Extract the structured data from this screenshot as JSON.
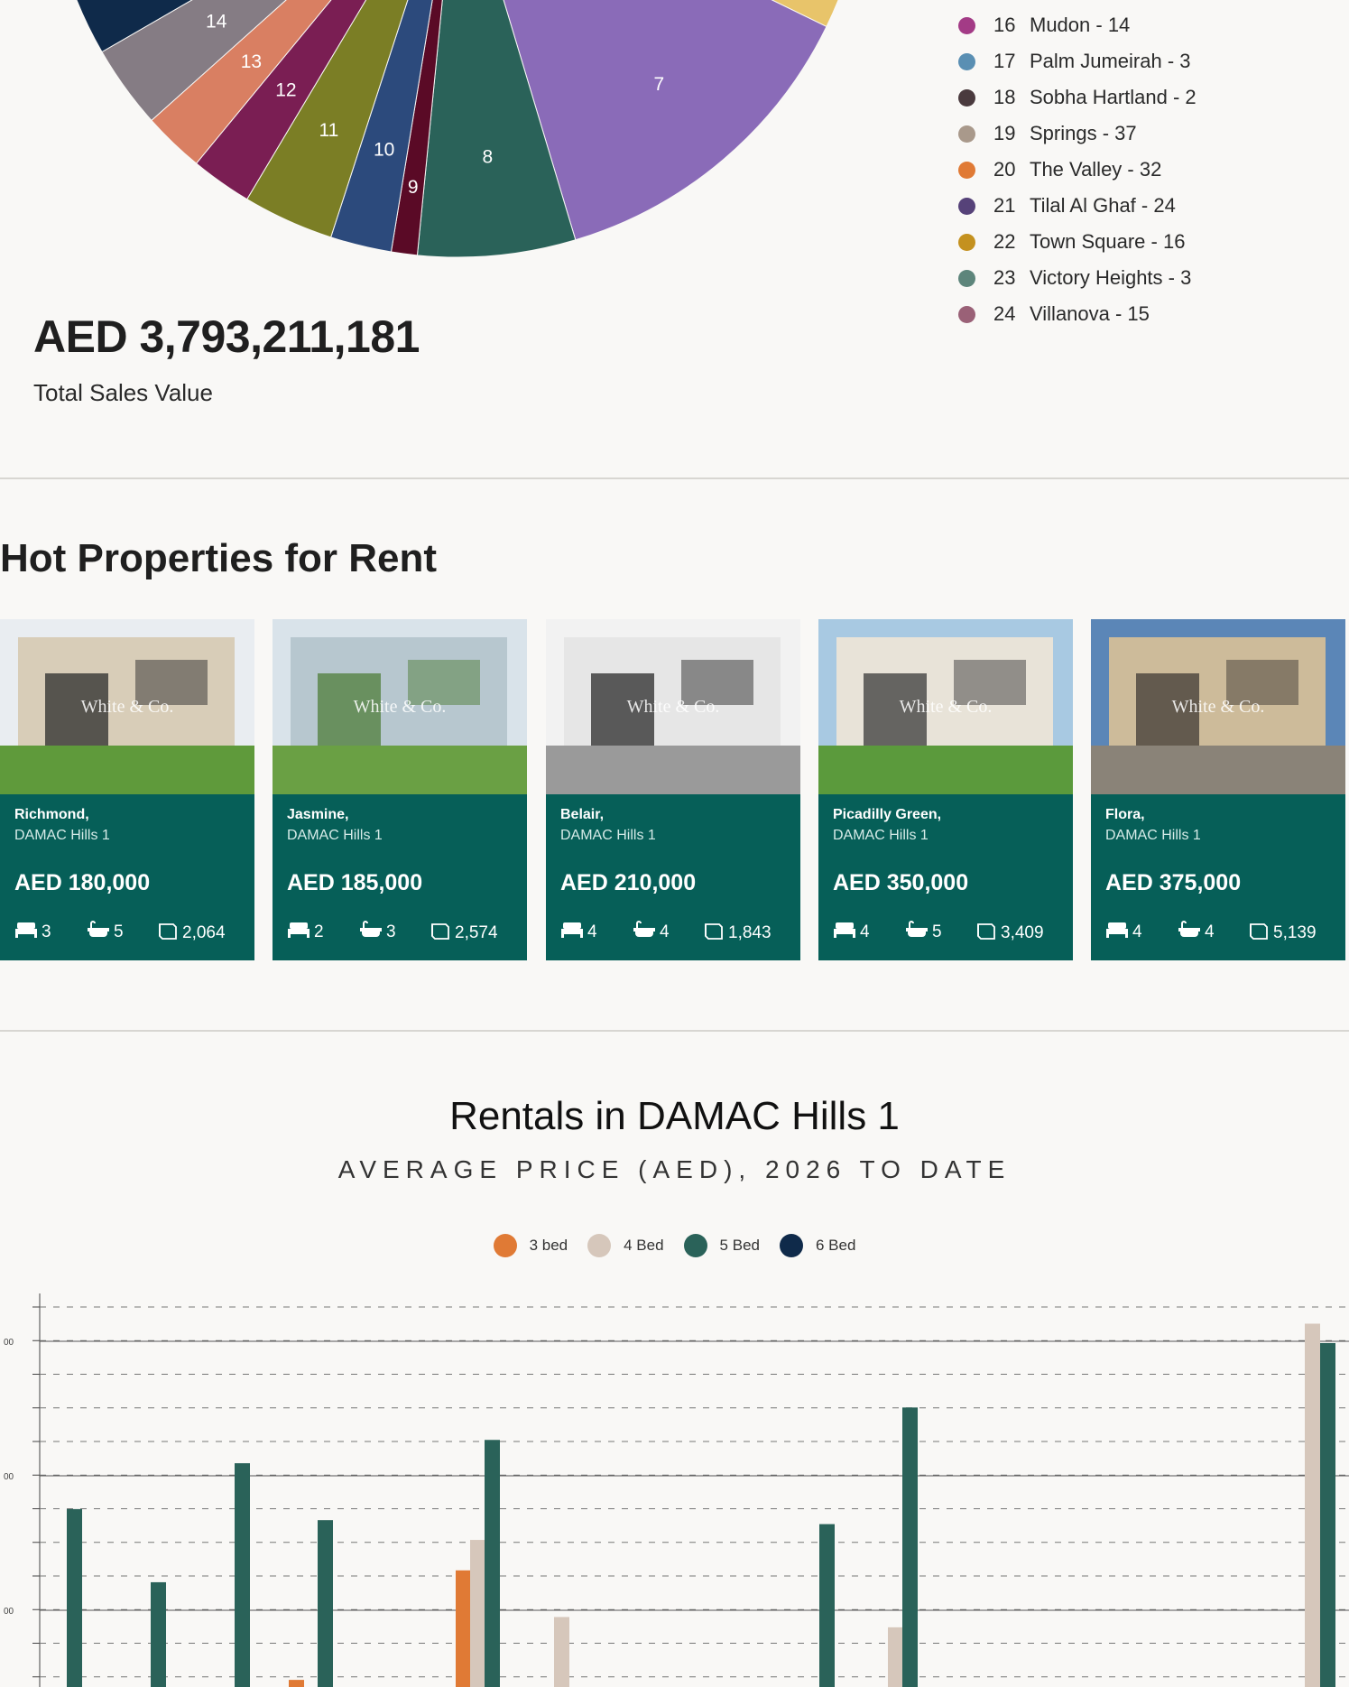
{
  "pie": {
    "slices": [
      {
        "label": "7",
        "value": 180,
        "color": "#8a6bb8"
      },
      {
        "label": "8",
        "value": 85,
        "color": "#2a6259"
      },
      {
        "label": "9",
        "value": 14,
        "color": "#5a0a26"
      },
      {
        "label": "10",
        "value": 33,
        "color": "#2c4a7c"
      },
      {
        "label": "11",
        "value": 49,
        "color": "#7b7e25"
      },
      {
        "label": "12",
        "value": 33,
        "color": "#7a1e53"
      },
      {
        "label": "13",
        "value": 33,
        "color": "#d97f62"
      },
      {
        "label": "14",
        "value": 45,
        "color": "#857c84"
      }
    ]
  },
  "legend": [
    {
      "num": "16",
      "name": "Mudon - 14",
      "color": "#a33b86"
    },
    {
      "num": "17",
      "name": "Palm Jumeirah - 3",
      "color": "#5a8fb3"
    },
    {
      "num": "18",
      "name": "Sobha Hartland - 2",
      "color": "#4a3a3e"
    },
    {
      "num": "19",
      "name": "Springs - 37",
      "color": "#a9998b"
    },
    {
      "num": "20",
      "name": "The Valley - 32",
      "color": "#e07a35"
    },
    {
      "num": "21",
      "name": "Tilal Al Ghaf - 24",
      "color": "#564279"
    },
    {
      "num": "22",
      "name": "Town Square - 16",
      "color": "#c4911f"
    },
    {
      "num": "23",
      "name": "Victory Heights - 3",
      "color": "#5d857b"
    },
    {
      "num": "24",
      "name": "Villanova - 15",
      "color": "#9a6177"
    }
  ],
  "total_sales": {
    "value": "AED 3,793,211,181",
    "label": "Total Sales Value"
  },
  "hot_properties": {
    "title": "Hot Properties for Rent",
    "watermark": "White & Co.",
    "cards": [
      {
        "name": "Richmond,",
        "area": "DAMAC Hills 1",
        "price": "AED 180,000",
        "beds": "3",
        "baths": "5",
        "size": "2,064"
      },
      {
        "name": "Jasmine,",
        "area": "DAMAC Hills 1",
        "price": "AED 185,000",
        "beds": "2",
        "baths": "3",
        "size": "2,574"
      },
      {
        "name": "Belair,",
        "area": "DAMAC Hills 1",
        "price": "AED 210,000",
        "beds": "4",
        "baths": "4",
        "size": "1,843"
      },
      {
        "name": "Picadilly Green,",
        "area": "DAMAC Hills 1",
        "price": "AED 350,000",
        "beds": "4",
        "baths": "5",
        "size": "3,409"
      },
      {
        "name": "Flora,",
        "area": "DAMAC Hills 1",
        "price": "AED 375,000",
        "beds": "4",
        "baths": "4",
        "size": "5,139"
      }
    ]
  },
  "rentals": {
    "title": "Rentals in DAMAC Hills 1",
    "subtitle": "AVERAGE PRICE (AED), 2026 TO DATE",
    "legend": [
      {
        "name": "3 bed",
        "color": "#e07a35"
      },
      {
        "name": "4 Bed",
        "color": "#d6c7bb"
      },
      {
        "name": "5 Bed",
        "color": "#2a6259"
      },
      {
        "name": "6 Bed",
        "color": "#0f2a4a"
      }
    ]
  },
  "chart_data": {
    "type": "bar",
    "title": "Rentals in DAMAC Hills 1",
    "subtitle": "AVERAGE PRICE (AED), 2026 TO DATE",
    "ylabel": "",
    "ylim": [
      0,
      1000
    ],
    "grid": true,
    "legend_position": "top",
    "note": "Values in relative units (y-axis tick labels cropped); 0 = bottom of visible area",
    "series": [
      {
        "name": "3 bed",
        "color": "#e07a35",
        "points": [
          {
            "x": 329,
            "value": 18
          },
          {
            "x": 514,
            "value": 295
          }
        ]
      },
      {
        "name": "4 Bed",
        "color": "#d6c7bb",
        "points": [
          {
            "x": 530,
            "value": 372
          },
          {
            "x": 623,
            "value": 177
          },
          {
            "x": 993,
            "value": 151
          },
          {
            "x": 1455,
            "value": 919
          }
        ]
      },
      {
        "name": "5 Bed",
        "color": "#2a6259",
        "points": [
          {
            "x": 83,
            "value": 450
          },
          {
            "x": 176,
            "value": 265
          },
          {
            "x": 269,
            "value": 566
          },
          {
            "x": 361,
            "value": 422
          },
          {
            "x": 546,
            "value": 625
          },
          {
            "x": 917,
            "value": 412
          },
          {
            "x": 1009,
            "value": 707
          },
          {
            "x": 1472,
            "value": 870
          }
        ]
      },
      {
        "name": "6 Bed",
        "color": "#0f2a4a",
        "points": []
      }
    ]
  }
}
